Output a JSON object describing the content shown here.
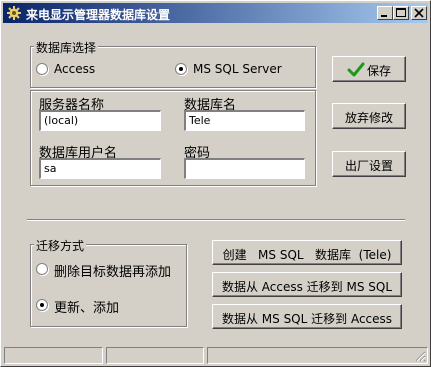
{
  "window": {
    "title": "来电显示管理器数据库设置",
    "buttons": {
      "minimize": "minimize",
      "maximize": "maximize",
      "close": "close"
    }
  },
  "db_select": {
    "legend": "数据库选择",
    "options": [
      {
        "label": "Access",
        "selected": false
      },
      {
        "label": "MS SQL Server",
        "selected": true
      }
    ]
  },
  "connection": {
    "server_label": "服务器名称",
    "server_value": "(local)",
    "database_label": "数据库名",
    "database_value": "Tele",
    "user_label": "数据库用户名",
    "user_value": "sa",
    "password_label": "密码",
    "password_value": ""
  },
  "actions": {
    "save_label": "保存",
    "discard_label": "放弃修改",
    "factory_label": "出厂设置"
  },
  "migration": {
    "legend": "迁移方式",
    "options": [
      {
        "label": "删除目标数据再添加",
        "selected": false
      },
      {
        "label": "更新、添加",
        "selected": true
      }
    ],
    "create_label": "创建   MS SQL   数据库  (Tele)",
    "access_to_sql_label": "数据从 Access 迁移到 MS SQL",
    "sql_to_access_label": "数据从 MS SQL 迁移到 Access"
  },
  "colors": {
    "face": "#d4d0c8",
    "title_start": "#0a246a",
    "title_end": "#a6caf0",
    "check_green": "#1a9a1a"
  }
}
